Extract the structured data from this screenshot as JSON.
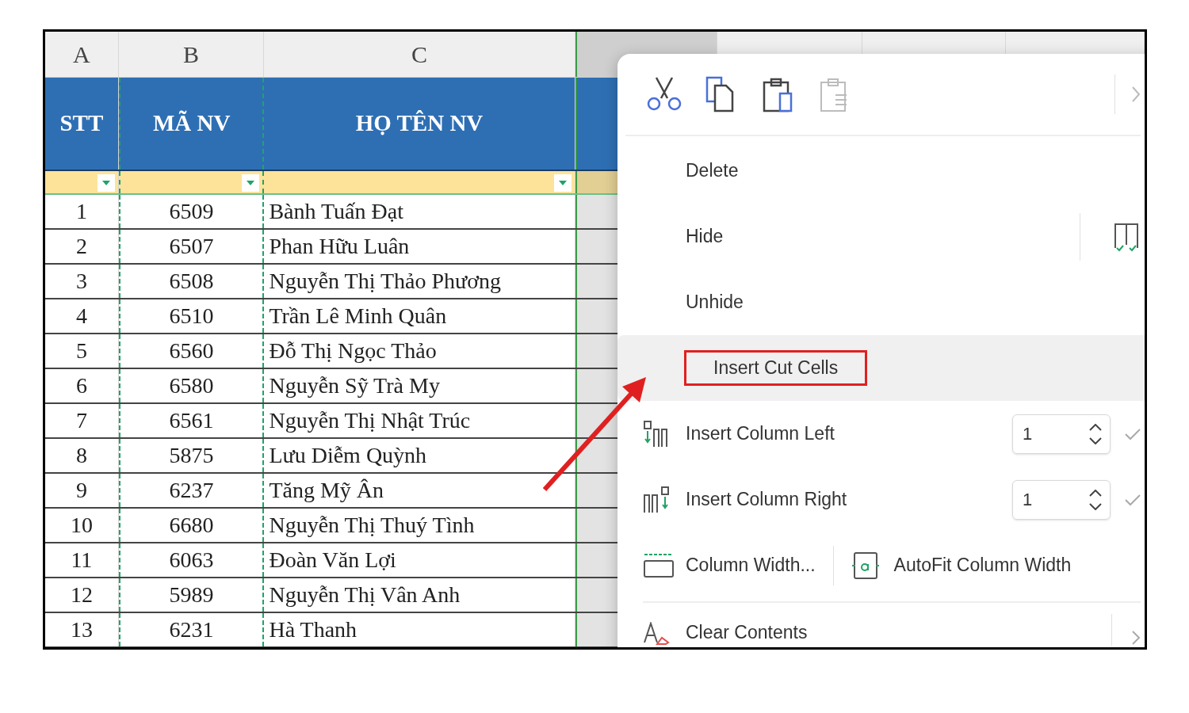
{
  "sheet": {
    "columns": [
      {
        "letter": "A",
        "heading": "STT",
        "selected": false,
        "cut": false
      },
      {
        "letter": "B",
        "heading": "MÃ NV",
        "selected": false,
        "cut": true
      },
      {
        "letter": "C",
        "heading": "HỌ TÊN NV",
        "selected": false,
        "cut": false
      }
    ],
    "covered_columns": [
      {
        "selected": true
      },
      {
        "selected": false
      },
      {
        "selected": false
      },
      {
        "selected": false
      }
    ],
    "rows": [
      [
        "1",
        "6509",
        "Bành Tuấn Đạt"
      ],
      [
        "2",
        "6507",
        "Phan Hữu Luân"
      ],
      [
        "3",
        "6508",
        "Nguyễn Thị Thảo Phương"
      ],
      [
        "4",
        "6510",
        "Trần Lê Minh Quân"
      ],
      [
        "5",
        "6560",
        "Đỗ Thị Ngọc Thảo"
      ],
      [
        "6",
        "6580",
        "Nguyễn Sỹ Trà My"
      ],
      [
        "7",
        "6561",
        "Nguyễn Thị Nhật Trúc"
      ],
      [
        "8",
        "5875",
        "Lưu Diễm Quỳnh"
      ],
      [
        "9",
        "6237",
        "Tăng Mỹ Ân"
      ],
      [
        "10",
        "6680",
        "Nguyễn Thị Thuý Tình"
      ],
      [
        "11",
        "6063",
        "Đoàn Văn Lợi"
      ],
      [
        "12",
        "5989",
        "Nguyễn Thị Vân Anh"
      ],
      [
        "13",
        "6231",
        "Hà Thanh"
      ]
    ]
  },
  "context_menu": {
    "toolbar": [
      {
        "kind": "cut",
        "disabled": false
      },
      {
        "kind": "copy",
        "disabled": false
      },
      {
        "kind": "paste",
        "disabled": false
      },
      {
        "kind": "paste-special",
        "disabled": true
      }
    ],
    "items": [
      {
        "kind": "plain",
        "label": "Delete",
        "highlighted": false,
        "annotated": false
      },
      {
        "kind": "split",
        "label": "Hide",
        "highlighted": false,
        "annotated": false
      },
      {
        "kind": "plain",
        "label": "Unhide",
        "highlighted": false,
        "annotated": false
      },
      {
        "kind": "plain",
        "label": "Insert Cut Cells",
        "highlighted": true,
        "annotated": true
      },
      {
        "kind": "count",
        "label": "Insert Column Left",
        "value": "1",
        "highlighted": false,
        "annotated": false
      },
      {
        "kind": "count",
        "label": "Insert Column Right",
        "value": "1",
        "highlighted": false,
        "annotated": false
      },
      {
        "kind": "pair",
        "label": "Column Width...",
        "second_label": "AutoFit Column Width",
        "highlighted": false,
        "annotated": false
      },
      {
        "kind": "submenu",
        "label": "Clear Contents",
        "highlighted": false,
        "annotated": false
      }
    ]
  }
}
